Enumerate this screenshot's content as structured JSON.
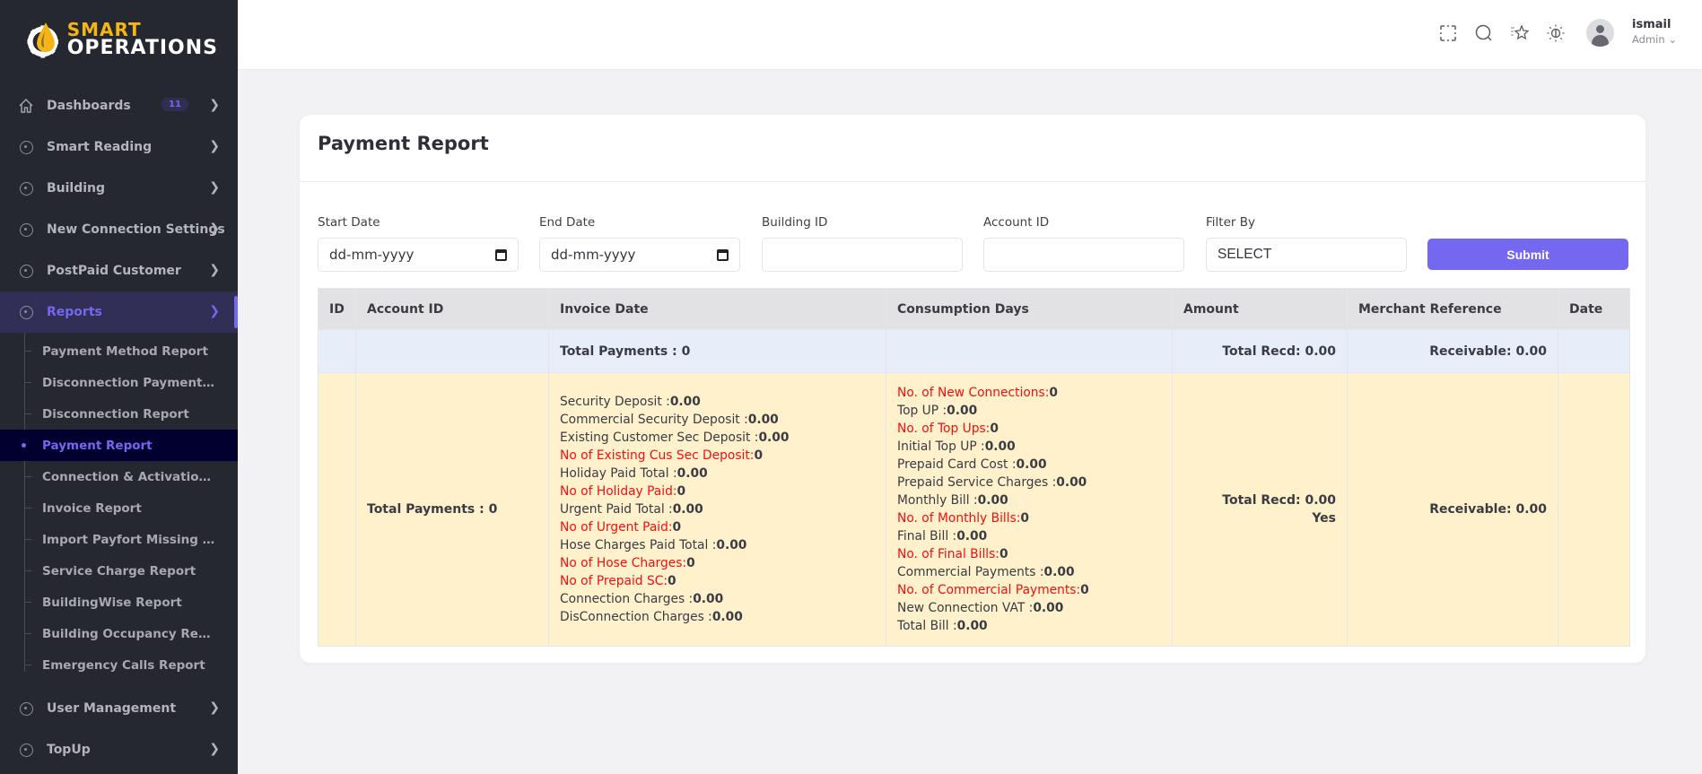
{
  "app": {
    "brand_top": "SMART",
    "brand_bottom": "OPERATIONS"
  },
  "sidebar": {
    "items": [
      {
        "label": "Dashboards",
        "icon": "home-icon",
        "badge": "11"
      },
      {
        "label": "Smart Reading",
        "icon": "circle-icon"
      },
      {
        "label": "Building",
        "icon": "circle-icon"
      },
      {
        "label": "New Connection Settings",
        "icon": "circle-icon"
      },
      {
        "label": "PostPaid Customer",
        "icon": "circle-icon"
      },
      {
        "label": "Reports",
        "icon": "circle-icon",
        "active": true
      },
      {
        "label": "User Management",
        "icon": "circle-icon"
      },
      {
        "label": "TopUp",
        "icon": "circle-icon"
      }
    ],
    "reports_sub": [
      {
        "label": "Payment Method Report"
      },
      {
        "label": "Disconnection Payment Report"
      },
      {
        "label": "Disconnection Report"
      },
      {
        "label": "Payment Report",
        "active": true
      },
      {
        "label": "Connection & Activation Report"
      },
      {
        "label": "Invoice Report"
      },
      {
        "label": "Import Payfort Missing Payments"
      },
      {
        "label": "Service Charge Report"
      },
      {
        "label": "BuildingWise Report"
      },
      {
        "label": "Building Occupancy Report"
      },
      {
        "label": "Emergency Calls Report"
      }
    ]
  },
  "header": {
    "icons": [
      "fullscreen-icon",
      "search-icon",
      "bookmark-star-icon",
      "theme-sun-icon"
    ],
    "user_name": "ismail",
    "user_role": "Admin"
  },
  "page": {
    "title": "Payment Report",
    "filters": {
      "start_date": {
        "label": "Start Date",
        "placeholder": "dd-mm-yyyy"
      },
      "end_date": {
        "label": "End Date",
        "placeholder": "dd-mm-yyyy"
      },
      "building_id": {
        "label": "Building ID",
        "value": ""
      },
      "account_id": {
        "label": "Account ID",
        "value": ""
      },
      "filter_by": {
        "label": "Filter By",
        "value": "SELECT"
      },
      "submit_label": "Submit"
    },
    "table": {
      "columns": [
        "ID",
        "Account ID",
        "Invoice Date",
        "Consumption Days",
        "Amount",
        "Merchant Reference",
        "Date"
      ],
      "summary_row": {
        "invoice_date": "Total Payments : 0",
        "amount": "Total Recd: 0.00",
        "merchant_reference": "Receivable: 0.00"
      },
      "detail_row": {
        "account_id": "Total Payments : 0",
        "invoice_lines": [
          {
            "label": "Security Deposit :",
            "value": "0.00",
            "highlight": false
          },
          {
            "label": "Commercial Security Deposit :",
            "value": "0.00",
            "highlight": false
          },
          {
            "label": "Existing Customer Sec Deposit :",
            "value": "0.00",
            "highlight": false
          },
          {
            "label": "No of Existing Cus Sec Deposit:",
            "value": "0",
            "highlight": true
          },
          {
            "label": "Holiday Paid Total :",
            "value": "0.00",
            "highlight": false
          },
          {
            "label": "No of Holiday Paid:",
            "value": "0",
            "highlight": true
          },
          {
            "label": "Urgent Paid Total :",
            "value": "0.00",
            "highlight": false
          },
          {
            "label": "No of Urgent Paid:",
            "value": "0",
            "highlight": true
          },
          {
            "label": "Hose Charges Paid Total :",
            "value": "0.00",
            "highlight": false
          },
          {
            "label": "No of Hose Charges:",
            "value": "0",
            "highlight": true
          },
          {
            "label": "No of Prepaid SC:",
            "value": "0",
            "highlight": true
          },
          {
            "label": "Connection Charges :",
            "value": "0.00",
            "highlight": false
          },
          {
            "label": "DisConnection Charges :",
            "value": "0.00",
            "highlight": false
          }
        ],
        "consumption_lines": [
          {
            "label": "No. of New Connections:",
            "value": "0",
            "highlight": true
          },
          {
            "label": "Top UP :",
            "value": "0.00",
            "highlight": false
          },
          {
            "label": "No. of Top Ups:",
            "value": "0",
            "highlight": true
          },
          {
            "label": "Initial Top UP :",
            "value": "0.00",
            "highlight": false
          },
          {
            "label": "Prepaid Card Cost :",
            "value": "0.00",
            "highlight": false
          },
          {
            "label": "Prepaid Service Charges :",
            "value": "0.00",
            "highlight": false
          },
          {
            "label": "Monthly Bill :",
            "value": "0.00",
            "highlight": false
          },
          {
            "label": "No. of Monthly Bills:",
            "value": "0",
            "highlight": true
          },
          {
            "label": "Final Bill :",
            "value": "0.00",
            "highlight": false
          },
          {
            "label": "No. of Final Bills:",
            "value": "0",
            "highlight": true
          },
          {
            "label": "Commercial Payments :",
            "value": "0.00",
            "highlight": false
          },
          {
            "label": "No. of Commercial Payments:",
            "value": "0",
            "highlight": true
          },
          {
            "label": "New Connection VAT :",
            "value": "0.00",
            "highlight": false
          },
          {
            "label": "Total Bill :",
            "value": "0.00",
            "highlight": false
          }
        ],
        "amount": "Total Recd: 0.00",
        "amount_note": "Yes",
        "merchant_reference": "Receivable: 0.00"
      }
    }
  },
  "colors": {
    "accent": "#7467f0",
    "sidebar_bg": "#252731",
    "highlight_text": "#ee1111",
    "summary_row_bg": "#e8edfa",
    "detail_row_bg": "#fff1cc"
  }
}
